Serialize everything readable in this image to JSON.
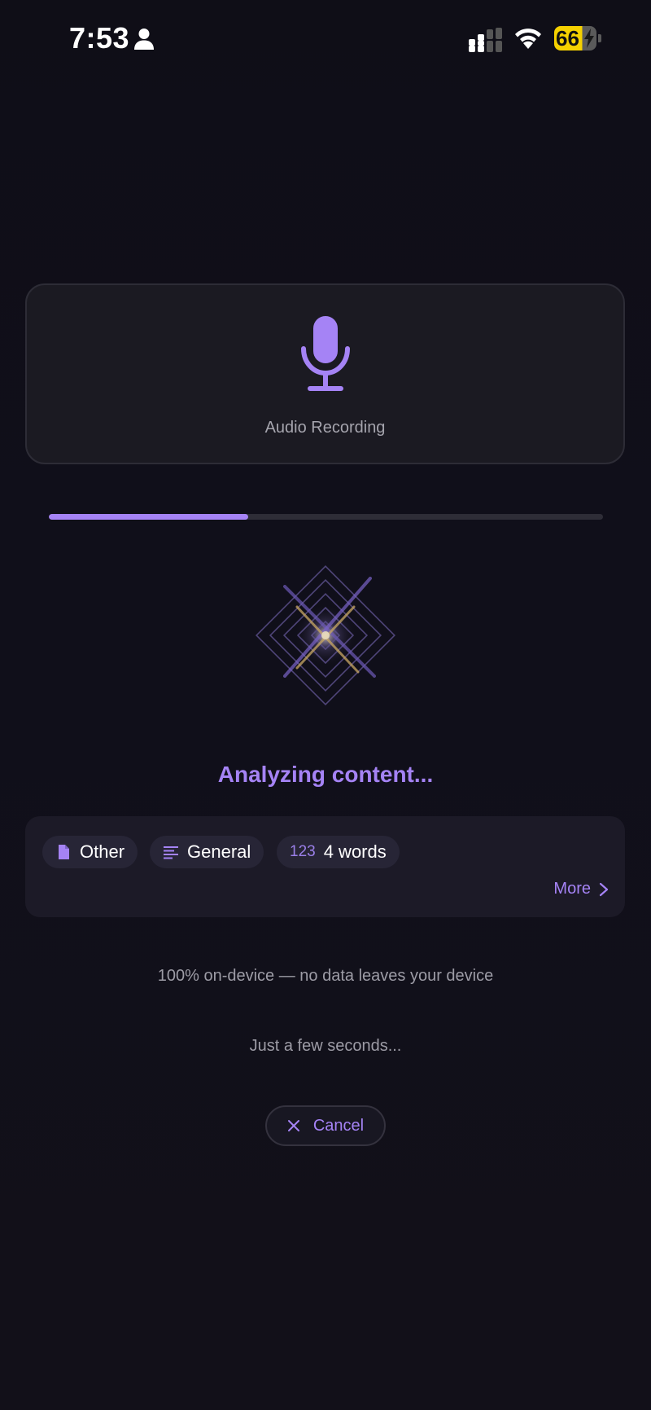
{
  "status_bar": {
    "time": "7:53",
    "battery_level": "66"
  },
  "source_card": {
    "icon": "microphone-icon",
    "label": "Audio Recording"
  },
  "progress": {
    "fraction": 0.36
  },
  "status_message": "Analyzing content...",
  "meta": {
    "chips": [
      {
        "icon": "document-icon",
        "label": "Other"
      },
      {
        "icon": "text-lines-icon",
        "label": "General"
      },
      {
        "icon_text": "123",
        "label": "4 words"
      }
    ],
    "more_label": "More"
  },
  "privacy_note": "100% on-device — no data leaves your device",
  "wait_note": "Just a few seconds...",
  "cancel_label": "Cancel",
  "colors": {
    "accent": "#a583f5",
    "background": "#0f0e17",
    "battery": "#f5d100"
  }
}
